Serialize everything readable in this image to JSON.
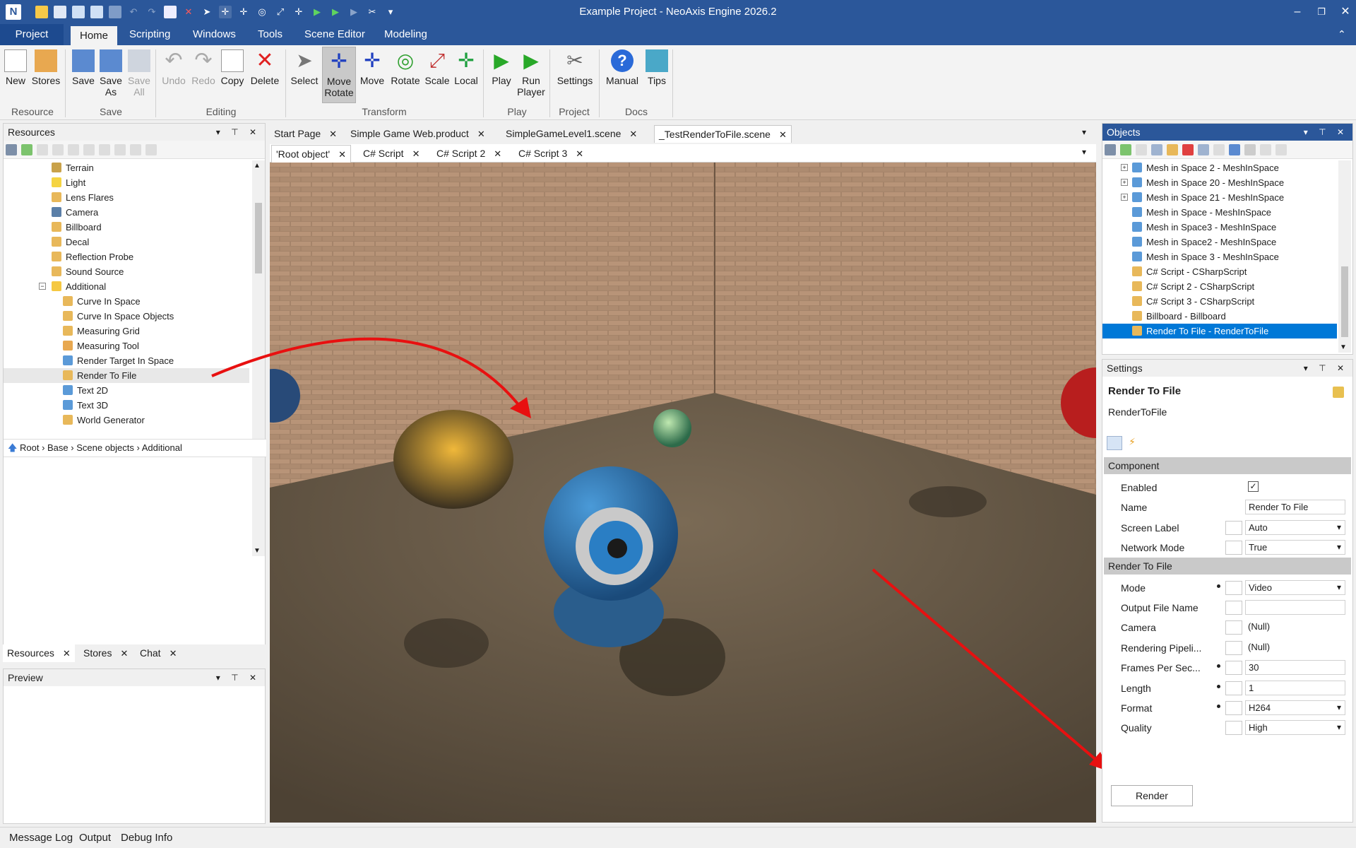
{
  "window": {
    "title": "Example Project - NeoAxis Engine 2026.2",
    "logo": "N"
  },
  "colors": {
    "accent": "#2b579a",
    "selection": "#0078d7"
  },
  "menu": {
    "tabs": [
      "Project",
      "Home",
      "Scripting",
      "Windows",
      "Tools",
      "Scene Editor",
      "Modeling"
    ],
    "active": "Home"
  },
  "ribbon": {
    "buttons": [
      {
        "label": "New",
        "icon": "new-icon"
      },
      {
        "label": "Stores",
        "icon": "stores-icon"
      },
      {
        "label": "Save",
        "icon": "save-icon"
      },
      {
        "label": "Save\nAs",
        "icon": "save-as-icon"
      },
      {
        "label": "Save\nAll",
        "icon": "save-all-icon"
      },
      {
        "label": "Undo",
        "icon": "undo-icon"
      },
      {
        "label": "Redo",
        "icon": "redo-icon"
      },
      {
        "label": "Copy",
        "icon": "copy-icon"
      },
      {
        "label": "Delete",
        "icon": "delete-icon"
      },
      {
        "label": "Select",
        "icon": "select-icon"
      },
      {
        "label": "Move\nRotate",
        "icon": "move-rotate-icon"
      },
      {
        "label": "Move",
        "icon": "move-icon"
      },
      {
        "label": "Rotate",
        "icon": "rotate-icon"
      },
      {
        "label": "Scale",
        "icon": "scale-icon"
      },
      {
        "label": "Local",
        "icon": "local-icon"
      },
      {
        "label": "Play",
        "icon": "play-icon"
      },
      {
        "label": "Run\nPlayer",
        "icon": "run-player-icon"
      },
      {
        "label": "Settings",
        "icon": "settings-icon"
      },
      {
        "label": "Manual",
        "icon": "manual-icon"
      },
      {
        "label": "Tips",
        "icon": "tips-icon"
      }
    ],
    "groups": [
      "Resource",
      "Save",
      "Editing",
      "Transform",
      "Play",
      "Project",
      "Docs"
    ]
  },
  "resources": {
    "title": "Resources",
    "items": [
      {
        "label": "Terrain",
        "indent": 1
      },
      {
        "label": "Light",
        "indent": 1
      },
      {
        "label": "Lens Flares",
        "indent": 1
      },
      {
        "label": "Camera",
        "indent": 1
      },
      {
        "label": "Billboard",
        "indent": 1
      },
      {
        "label": "Decal",
        "indent": 1
      },
      {
        "label": "Reflection Probe",
        "indent": 1
      },
      {
        "label": "Sound Source",
        "indent": 1
      },
      {
        "label": "Additional",
        "indent": 0,
        "folder": true
      },
      {
        "label": "Curve In Space",
        "indent": 2
      },
      {
        "label": "Curve In Space Objects",
        "indent": 2
      },
      {
        "label": "Measuring Grid",
        "indent": 2
      },
      {
        "label": "Measuring Tool",
        "indent": 2
      },
      {
        "label": "Render Target In Space",
        "indent": 2
      },
      {
        "label": "Render To File",
        "indent": 2,
        "selected": true
      },
      {
        "label": "Text 2D",
        "indent": 2
      },
      {
        "label": "Text 3D",
        "indent": 2
      },
      {
        "label": "World Generator",
        "indent": 2
      }
    ],
    "breadcrumb": [
      "Root",
      "Base",
      "Scene objects",
      "Additional"
    ],
    "bottom_tabs": [
      "Resources",
      "Stores",
      "Chat"
    ]
  },
  "preview": {
    "title": "Preview"
  },
  "documents": {
    "tabs": [
      "Start Page",
      "Simple Game Web.product",
      "SimpleGameLevel1.scene",
      "_TestRenderToFile.scene"
    ],
    "subtabs": [
      "'Root object'",
      "C# Script",
      "C# Script 2",
      "C# Script 3"
    ]
  },
  "objects": {
    "title": "Objects",
    "items": [
      {
        "label": "Mesh in Space 2 - MeshInSpace",
        "expand": true
      },
      {
        "label": "Mesh in Space 20 - MeshInSpace",
        "expand": true
      },
      {
        "label": "Mesh in Space 21 - MeshInSpace",
        "expand": true
      },
      {
        "label": "Mesh in Space - MeshInSpace"
      },
      {
        "label": "Mesh in Space3 - MeshInSpace"
      },
      {
        "label": "Mesh in Space2 - MeshInSpace"
      },
      {
        "label": "Mesh in Space 3 - MeshInSpace"
      },
      {
        "label": "C# Script - CSharpScript"
      },
      {
        "label": "C# Script 2 - CSharpScript"
      },
      {
        "label": "C# Script 3 - CSharpScript"
      },
      {
        "label": "Billboard - Billboard"
      },
      {
        "label": "Render To File - RenderToFile",
        "selected": true
      }
    ]
  },
  "settings": {
    "title": "Settings",
    "object_title": "Render To File",
    "object_type": "RenderToFile",
    "cat_component": "Component",
    "cat_render": "Render To File",
    "component": [
      {
        "label": "Enabled",
        "type": "check",
        "checked": true
      },
      {
        "label": "Name",
        "value": "Render To File"
      },
      {
        "label": "Screen Label",
        "value": "Auto",
        "dd": true,
        "box": true
      },
      {
        "label": "Network Mode",
        "value": "True",
        "dd": true,
        "box": true
      }
    ],
    "render": [
      {
        "label": "Mode",
        "value": "Video",
        "dd": true,
        "box": true,
        "dot": true
      },
      {
        "label": "Output File Name",
        "value": "",
        "box": true
      },
      {
        "label": "Camera",
        "value": "(Null)",
        "box": true,
        "plain": true
      },
      {
        "label": "Rendering Pipeli...",
        "value": "(Null)",
        "box": true,
        "plain": true
      },
      {
        "label": "Frames Per Sec...",
        "value": "30",
        "box": true,
        "dot": true
      },
      {
        "label": "Length",
        "value": "1",
        "box": true,
        "dot": true
      },
      {
        "label": "Format",
        "value": "H264",
        "dd": true,
        "box": true,
        "dot": true
      },
      {
        "label": "Quality",
        "value": "High",
        "dd": true,
        "box": true
      }
    ],
    "render_button": "Render"
  },
  "statusbar": [
    "Message Log",
    "Output",
    "Debug Info"
  ]
}
